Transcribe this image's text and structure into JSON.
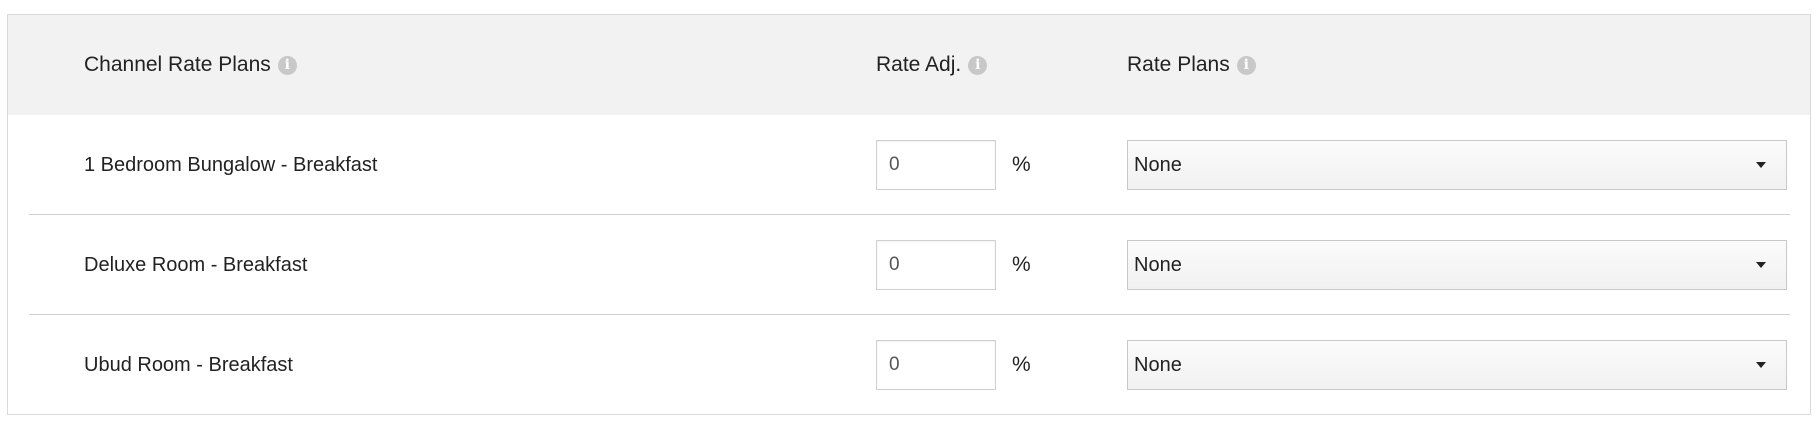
{
  "header": {
    "channel_rate_plans": "Channel Rate Plans",
    "rate_adj": "Rate Adj.",
    "rate_plans": "Rate Plans",
    "info_glyph": "i"
  },
  "rows": [
    {
      "label": "1 Bedroom Bungalow - Breakfast",
      "adjustment": "0",
      "unit": "%",
      "rate_plan": "None"
    },
    {
      "label": "Deluxe Room - Breakfast",
      "adjustment": "0",
      "unit": "%",
      "rate_plan": "None"
    },
    {
      "label": "Ubud Room - Breakfast",
      "adjustment": "0",
      "unit": "%",
      "rate_plan": "None"
    }
  ],
  "colors": {
    "header_bg": "#f2f2f2",
    "border": "#d9d9d9",
    "info_icon": "#c8c8c8",
    "text": "#222222"
  },
  "icons": {
    "info": "info-circle-icon",
    "dropdown": "caret-down-icon"
  }
}
